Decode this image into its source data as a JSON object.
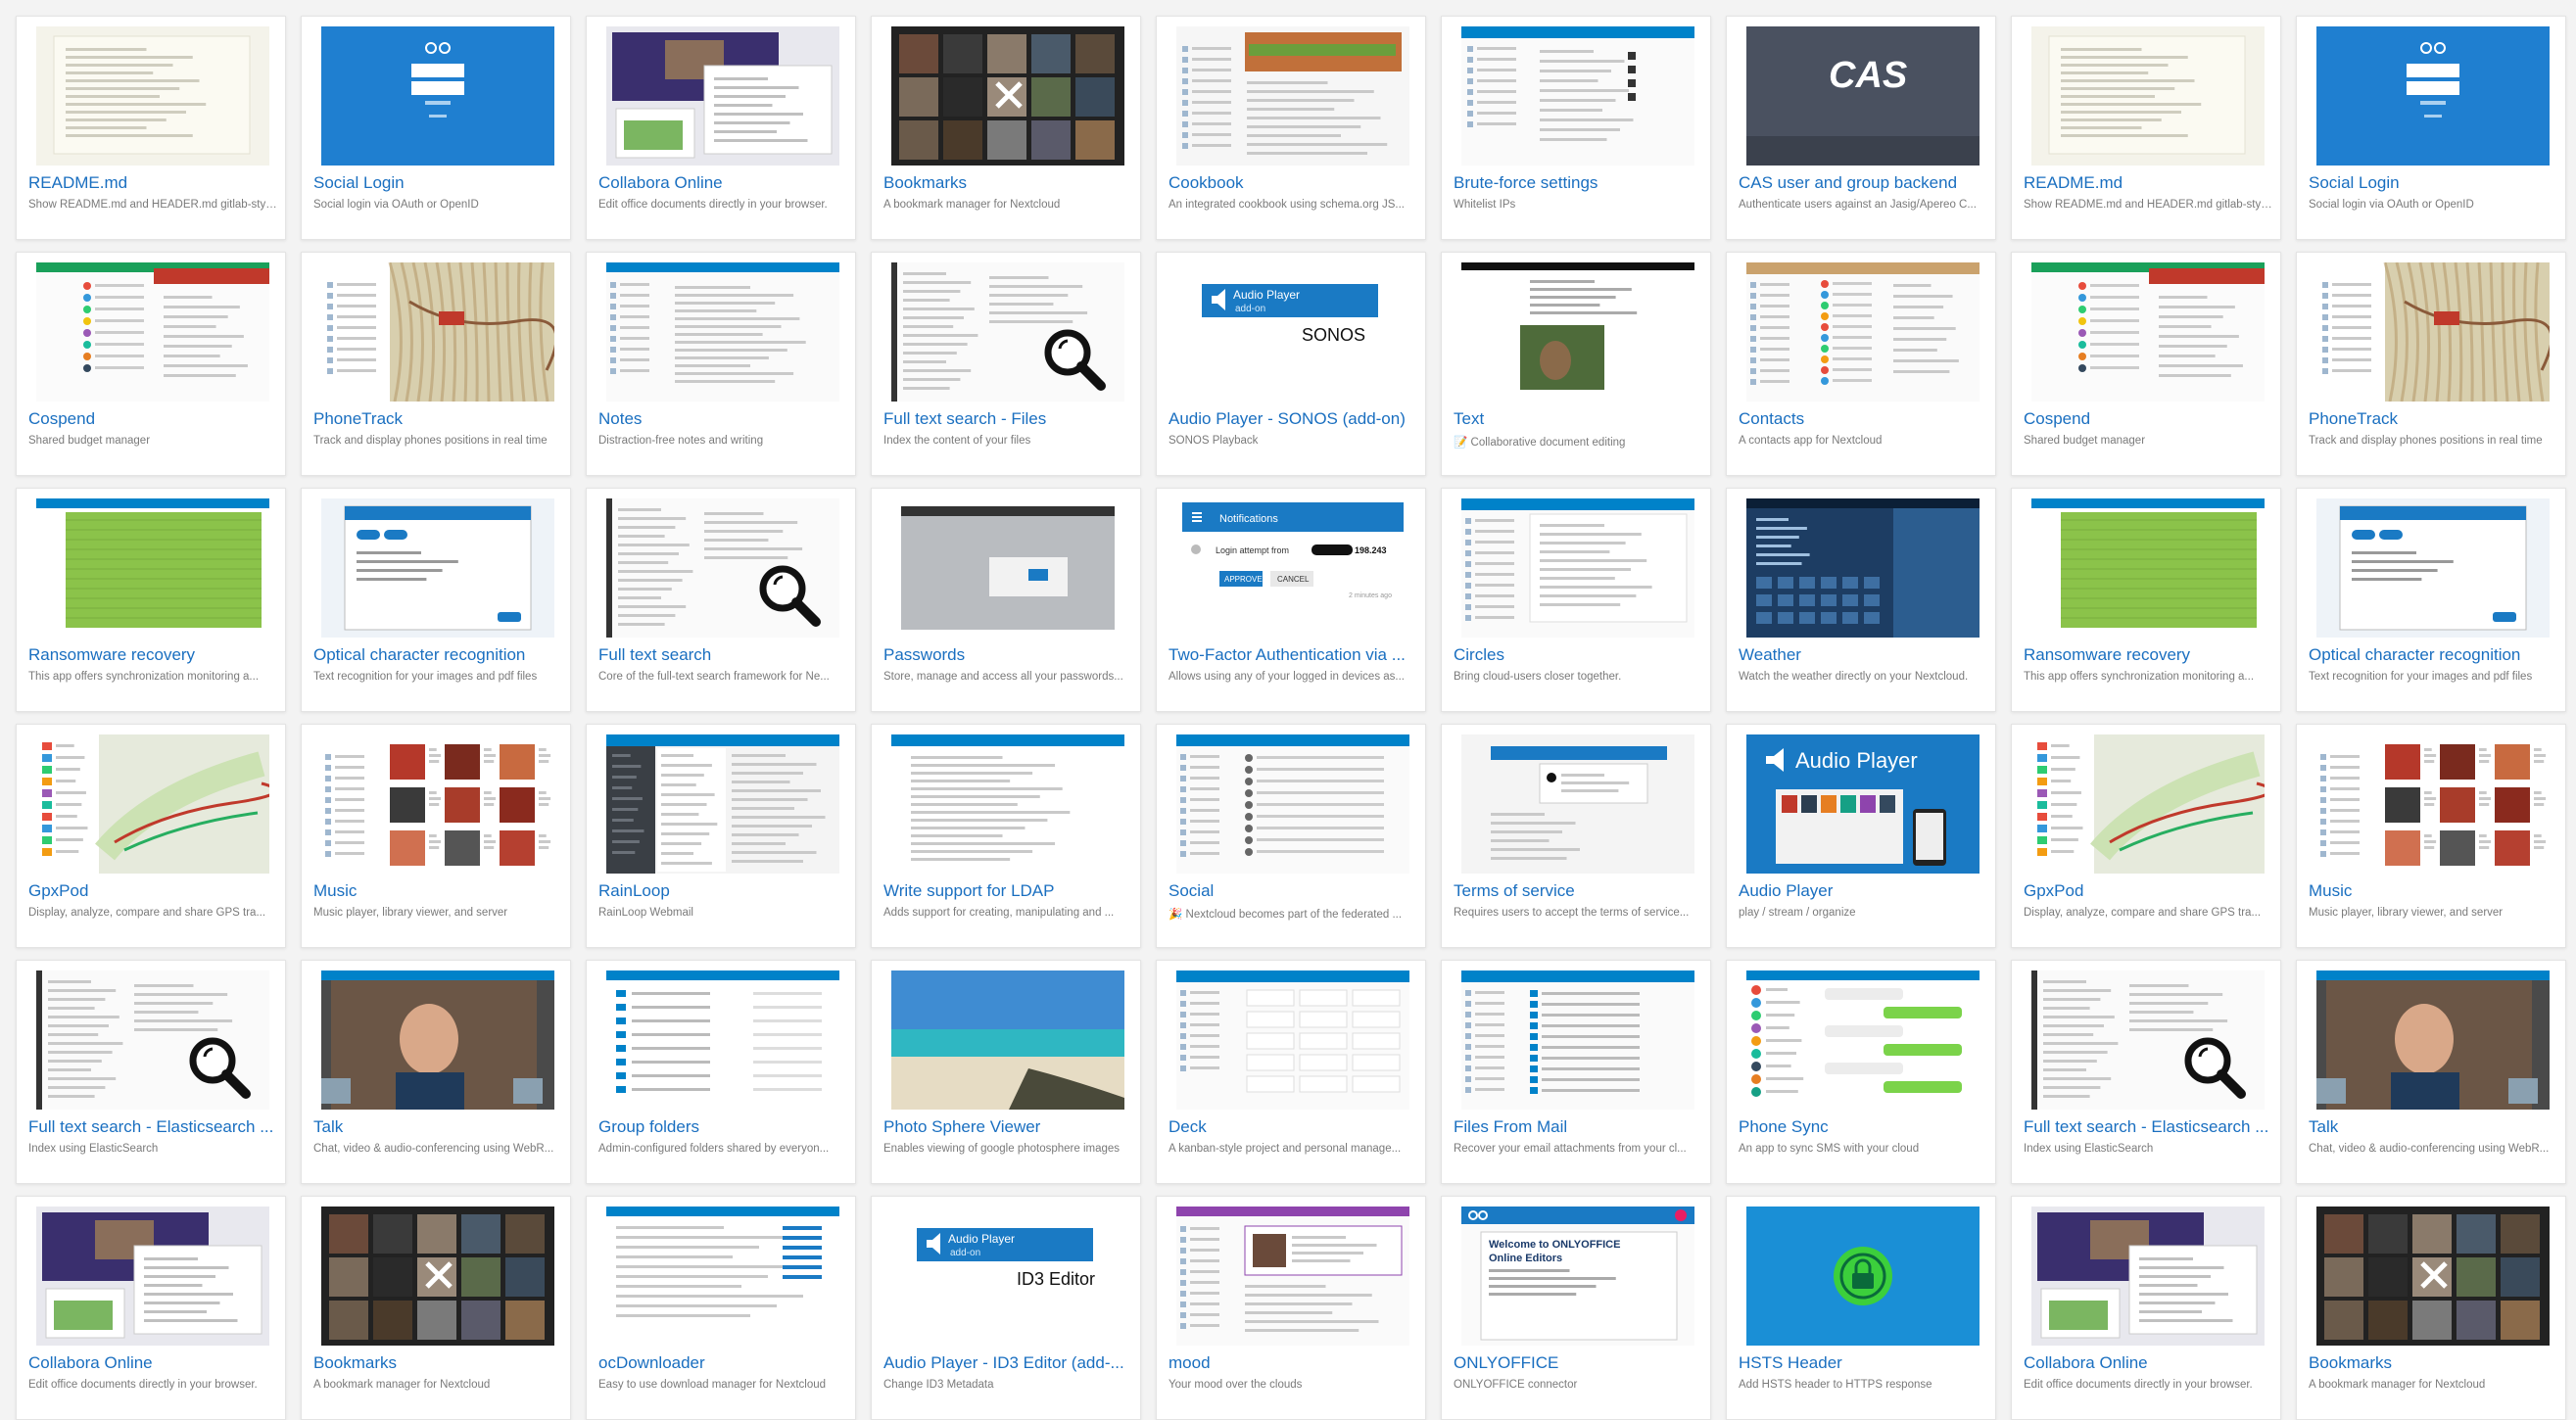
{
  "apps": [
    {
      "title": "README.md",
      "desc": "Show README.md and HEADER.md gitlab-styl...",
      "thumb": "doc",
      "icon": "document-screenshot-icon"
    },
    {
      "title": "Social Login",
      "desc": "Social login via OAuth or OpenID",
      "thumb": "login",
      "icon": "login-screen-icon"
    },
    {
      "title": "Collabora Online",
      "desc": "Edit office documents directly in your browser.",
      "thumb": "office",
      "icon": "office-suite-icon"
    },
    {
      "title": "Bookmarks",
      "desc": "A bookmark manager for Nextcloud",
      "thumb": "bookmarks",
      "icon": "bookmarks-grid-icon"
    },
    {
      "title": "Cookbook",
      "desc": "An integrated cookbook using schema.org JS...",
      "thumb": "cookbook",
      "icon": "cookbook-recipe-icon"
    },
    {
      "title": "Brute-force settings",
      "desc": "Whitelist IPs",
      "thumb": "settings",
      "icon": "settings-form-icon"
    },
    {
      "title": "CAS user and group backend",
      "desc": "Authenticate users against an Jasig/Apereo C...",
      "thumb": "cas",
      "icon": "cas-logo-icon",
      "label": "CAS"
    },
    {
      "title": "README.md",
      "desc": "Show README.md and HEADER.md gitlab-styl...",
      "thumb": "doc",
      "icon": "document-screenshot-icon"
    },
    {
      "title": "Social Login",
      "desc": "Social login via OAuth or OpenID",
      "thumb": "login",
      "icon": "login-screen-icon"
    },
    {
      "title": "Cospend",
      "desc": "Shared budget manager",
      "thumb": "cospend",
      "icon": "budget-list-icon"
    },
    {
      "title": "PhoneTrack",
      "desc": "Track and display phones positions in real time",
      "thumb": "map",
      "icon": "map-track-icon"
    },
    {
      "title": "Notes",
      "desc": "Distraction-free notes and writing",
      "thumb": "notes",
      "icon": "notes-editor-icon"
    },
    {
      "title": "Full text search - Files",
      "desc": "Index the content of your files",
      "thumb": "search",
      "icon": "magnifier-icon"
    },
    {
      "title": "Audio Player - SONOS (add-on)",
      "desc": "SONOS Playback",
      "thumb": "audio_addon",
      "icon": "speaker-icon",
      "label": "Audio Player",
      "sub": "add-on",
      "extra": "SONOS"
    },
    {
      "title": "Text",
      "desc": "📝 Collaborative document editing",
      "thumb": "text",
      "icon": "text-editor-icon"
    },
    {
      "title": "Contacts",
      "desc": "A contacts app for Nextcloud",
      "thumb": "contacts",
      "icon": "contacts-list-icon"
    },
    {
      "title": "Cospend",
      "desc": "Shared budget manager",
      "thumb": "cospend",
      "icon": "budget-list-icon"
    },
    {
      "title": "PhoneTrack",
      "desc": "Track and display phones positions in real time",
      "thumb": "map",
      "icon": "map-track-icon"
    },
    {
      "title": "Ransomware recovery",
      "desc": "This app offers synchronization monitoring a...",
      "thumb": "ransom",
      "icon": "sync-table-icon"
    },
    {
      "title": "Optical character recognition",
      "desc": "Text recognition for your images and pdf files",
      "thumb": "ocr",
      "icon": "ocr-dialog-icon"
    },
    {
      "title": "Full text search",
      "desc": "Core of the full-text search framework for Ne...",
      "thumb": "search",
      "icon": "magnifier-icon"
    },
    {
      "title": "Passwords",
      "desc": "Store, manage and access all your passwords...",
      "thumb": "passwords",
      "icon": "password-manager-icon"
    },
    {
      "title": "Two-Factor Authentication via ...",
      "desc": "Allows using any of your logged in devices as...",
      "thumb": "twofactor",
      "icon": "notification-icon",
      "label": "Notifications",
      "login": "Login attempt from",
      "ip": "198.243",
      "approve": "APPROVE",
      "cancel": "CANCEL",
      "time": "2 minutes ago"
    },
    {
      "title": "Circles",
      "desc": "Bring cloud-users closer together.",
      "thumb": "circles",
      "icon": "circles-list-icon"
    },
    {
      "title": "Weather",
      "desc": "Watch the weather directly on your Nextcloud.",
      "thumb": "weather",
      "icon": "weather-widget-icon"
    },
    {
      "title": "Ransomware recovery",
      "desc": "This app offers synchronization monitoring a...",
      "thumb": "ransom",
      "icon": "sync-table-icon"
    },
    {
      "title": "Optical character recognition",
      "desc": "Text recognition for your images and pdf files",
      "thumb": "ocr",
      "icon": "ocr-dialog-icon"
    },
    {
      "title": "GpxPod",
      "desc": "Display, analyze, compare and share GPS tra...",
      "thumb": "gpx",
      "icon": "gps-map-icon"
    },
    {
      "title": "Music",
      "desc": "Music player, library viewer, and server",
      "thumb": "music",
      "icon": "music-library-icon"
    },
    {
      "title": "RainLoop",
      "desc": "RainLoop Webmail",
      "thumb": "rainloop",
      "icon": "webmail-icon"
    },
    {
      "title": "Write support for LDAP",
      "desc": "Adds support for creating, manipulating and ...",
      "thumb": "ldap",
      "icon": "ldap-settings-icon"
    },
    {
      "title": "Social",
      "desc": "🎉 Nextcloud becomes part of the federated ...",
      "thumb": "social",
      "icon": "social-feed-icon"
    },
    {
      "title": "Terms of service",
      "desc": "Requires users to accept the terms of service...",
      "thumb": "terms",
      "icon": "terms-dialog-icon"
    },
    {
      "title": "Audio Player",
      "desc": "play / stream / organize",
      "thumb": "audioplayer",
      "icon": "audio-player-icon",
      "label": "Audio Player"
    },
    {
      "title": "GpxPod",
      "desc": "Display, analyze, compare and share GPS tra...",
      "thumb": "gpx",
      "icon": "gps-map-icon"
    },
    {
      "title": "Music",
      "desc": "Music player, library viewer, and server",
      "thumb": "music",
      "icon": "music-library-icon"
    },
    {
      "title": "Full text search - Elasticsearch ...",
      "desc": "Index using ElasticSearch",
      "thumb": "search",
      "icon": "magnifier-icon"
    },
    {
      "title": "Talk",
      "desc": "Chat, video & audio-conferencing using WebR...",
      "thumb": "talk",
      "icon": "video-call-icon"
    },
    {
      "title": "Group folders",
      "desc": "Admin-configured folders shared by everyon...",
      "thumb": "folders",
      "icon": "folder-list-icon"
    },
    {
      "title": "Photo Sphere Viewer",
      "desc": "Enables viewing of google photosphere images",
      "thumb": "photosphere",
      "icon": "beach-photo-icon"
    },
    {
      "title": "Deck",
      "desc": "A kanban-style project and personal manage...",
      "thumb": "deck",
      "icon": "kanban-board-icon"
    },
    {
      "title": "Files From Mail",
      "desc": "Recover your email attachments from your cl...",
      "thumb": "filesmail",
      "icon": "files-mail-icon"
    },
    {
      "title": "Phone Sync",
      "desc": "An app to sync SMS with your cloud",
      "thumb": "phonesync",
      "icon": "sms-chat-icon"
    },
    {
      "title": "Full text search - Elasticsearch ...",
      "desc": "Index using ElasticSearch",
      "thumb": "search",
      "icon": "magnifier-icon"
    },
    {
      "title": "Talk",
      "desc": "Chat, video & audio-conferencing using WebR...",
      "thumb": "talk",
      "icon": "video-call-icon"
    },
    {
      "title": "Collabora Online",
      "desc": "Edit office documents directly in your browser.",
      "thumb": "office",
      "icon": "office-suite-icon"
    },
    {
      "title": "Bookmarks",
      "desc": "A bookmark manager for Nextcloud",
      "thumb": "bookmarks",
      "icon": "bookmarks-grid-icon"
    },
    {
      "title": "ocDownloader",
      "desc": "Easy to use download manager for Nextcloud",
      "thumb": "downloader",
      "icon": "download-list-icon"
    },
    {
      "title": "Audio Player - ID3 Editor (add-...",
      "desc": "Change ID3 Metadata",
      "thumb": "audio_addon",
      "icon": "speaker-icon",
      "label": "Audio Player",
      "sub": "add-on",
      "extra": "ID3 Editor"
    },
    {
      "title": "mood",
      "desc": "Your mood over the clouds",
      "thumb": "mood",
      "icon": "mood-feed-icon"
    },
    {
      "title": "ONLYOFFICE",
      "desc": "ONLYOFFICE connector",
      "thumb": "onlyoffice",
      "icon": "onlyoffice-welcome-icon",
      "label": "Welcome to ONLYOFFICE",
      "sub": "Online Editors"
    },
    {
      "title": "HSTS Header",
      "desc": "Add HSTS header to HTTPS response",
      "thumb": "hsts",
      "icon": "lock-icon"
    },
    {
      "title": "Collabora Online",
      "desc": "Edit office documents directly in your browser.",
      "thumb": "office",
      "icon": "office-suite-icon"
    },
    {
      "title": "Bookmarks",
      "desc": "A bookmark manager for Nextcloud",
      "thumb": "bookmarks",
      "icon": "bookmarks-grid-icon"
    }
  ]
}
